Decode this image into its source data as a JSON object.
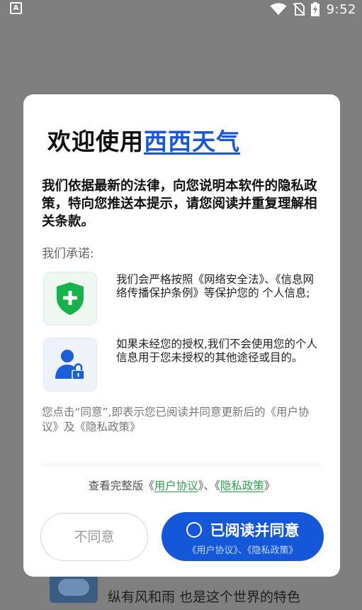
{
  "status_bar": {
    "left_icon": "A",
    "time": "9:52",
    "icons": [
      "wifi-icon",
      "no-sim-icon",
      "battery-charging-icon"
    ]
  },
  "background_app": {
    "tagline": "纵有风和雨  也是这个世界的特色"
  },
  "dialog": {
    "title_prefix": "欢迎使用",
    "title_brand": "西西天气",
    "intro": "我们依据最新的法律，向您说明本软件的隐私政策，特向您推送本提示，请您阅读并重复理解相关条款。",
    "promise_heading": "我们承诺:",
    "features": [
      {
        "icon": "shield-plus-icon",
        "text": "我们会严格按照《网络安全法》、《信息网络传播保护条例》等保护您的 个人信息;"
      },
      {
        "icon": "user-lock-icon",
        "text": "如果未经您的授权,我们不会使用您的个人信息用于您未授权的其他途径或目的。"
      }
    ],
    "agree_note": "您点击“同意”,即表示您已阅读并同意更新后的《用户协议》及《隐私政策》",
    "links_prefix": "查看完整版《",
    "user_agreement_link": "用户协议",
    "links_middle": "》、《",
    "privacy_policy_link": "隐私政策",
    "links_suffix": "》",
    "disagree_button": "不同意",
    "agree_button": "已阅读并同意",
    "agree_button_sub": "《用户协议》、《隐私政策》"
  },
  "colors": {
    "accent_blue": "#1557d9",
    "link_green": "#2e9f4a",
    "shield_green": "#16b24a",
    "user_blue": "#1a5fd6"
  }
}
